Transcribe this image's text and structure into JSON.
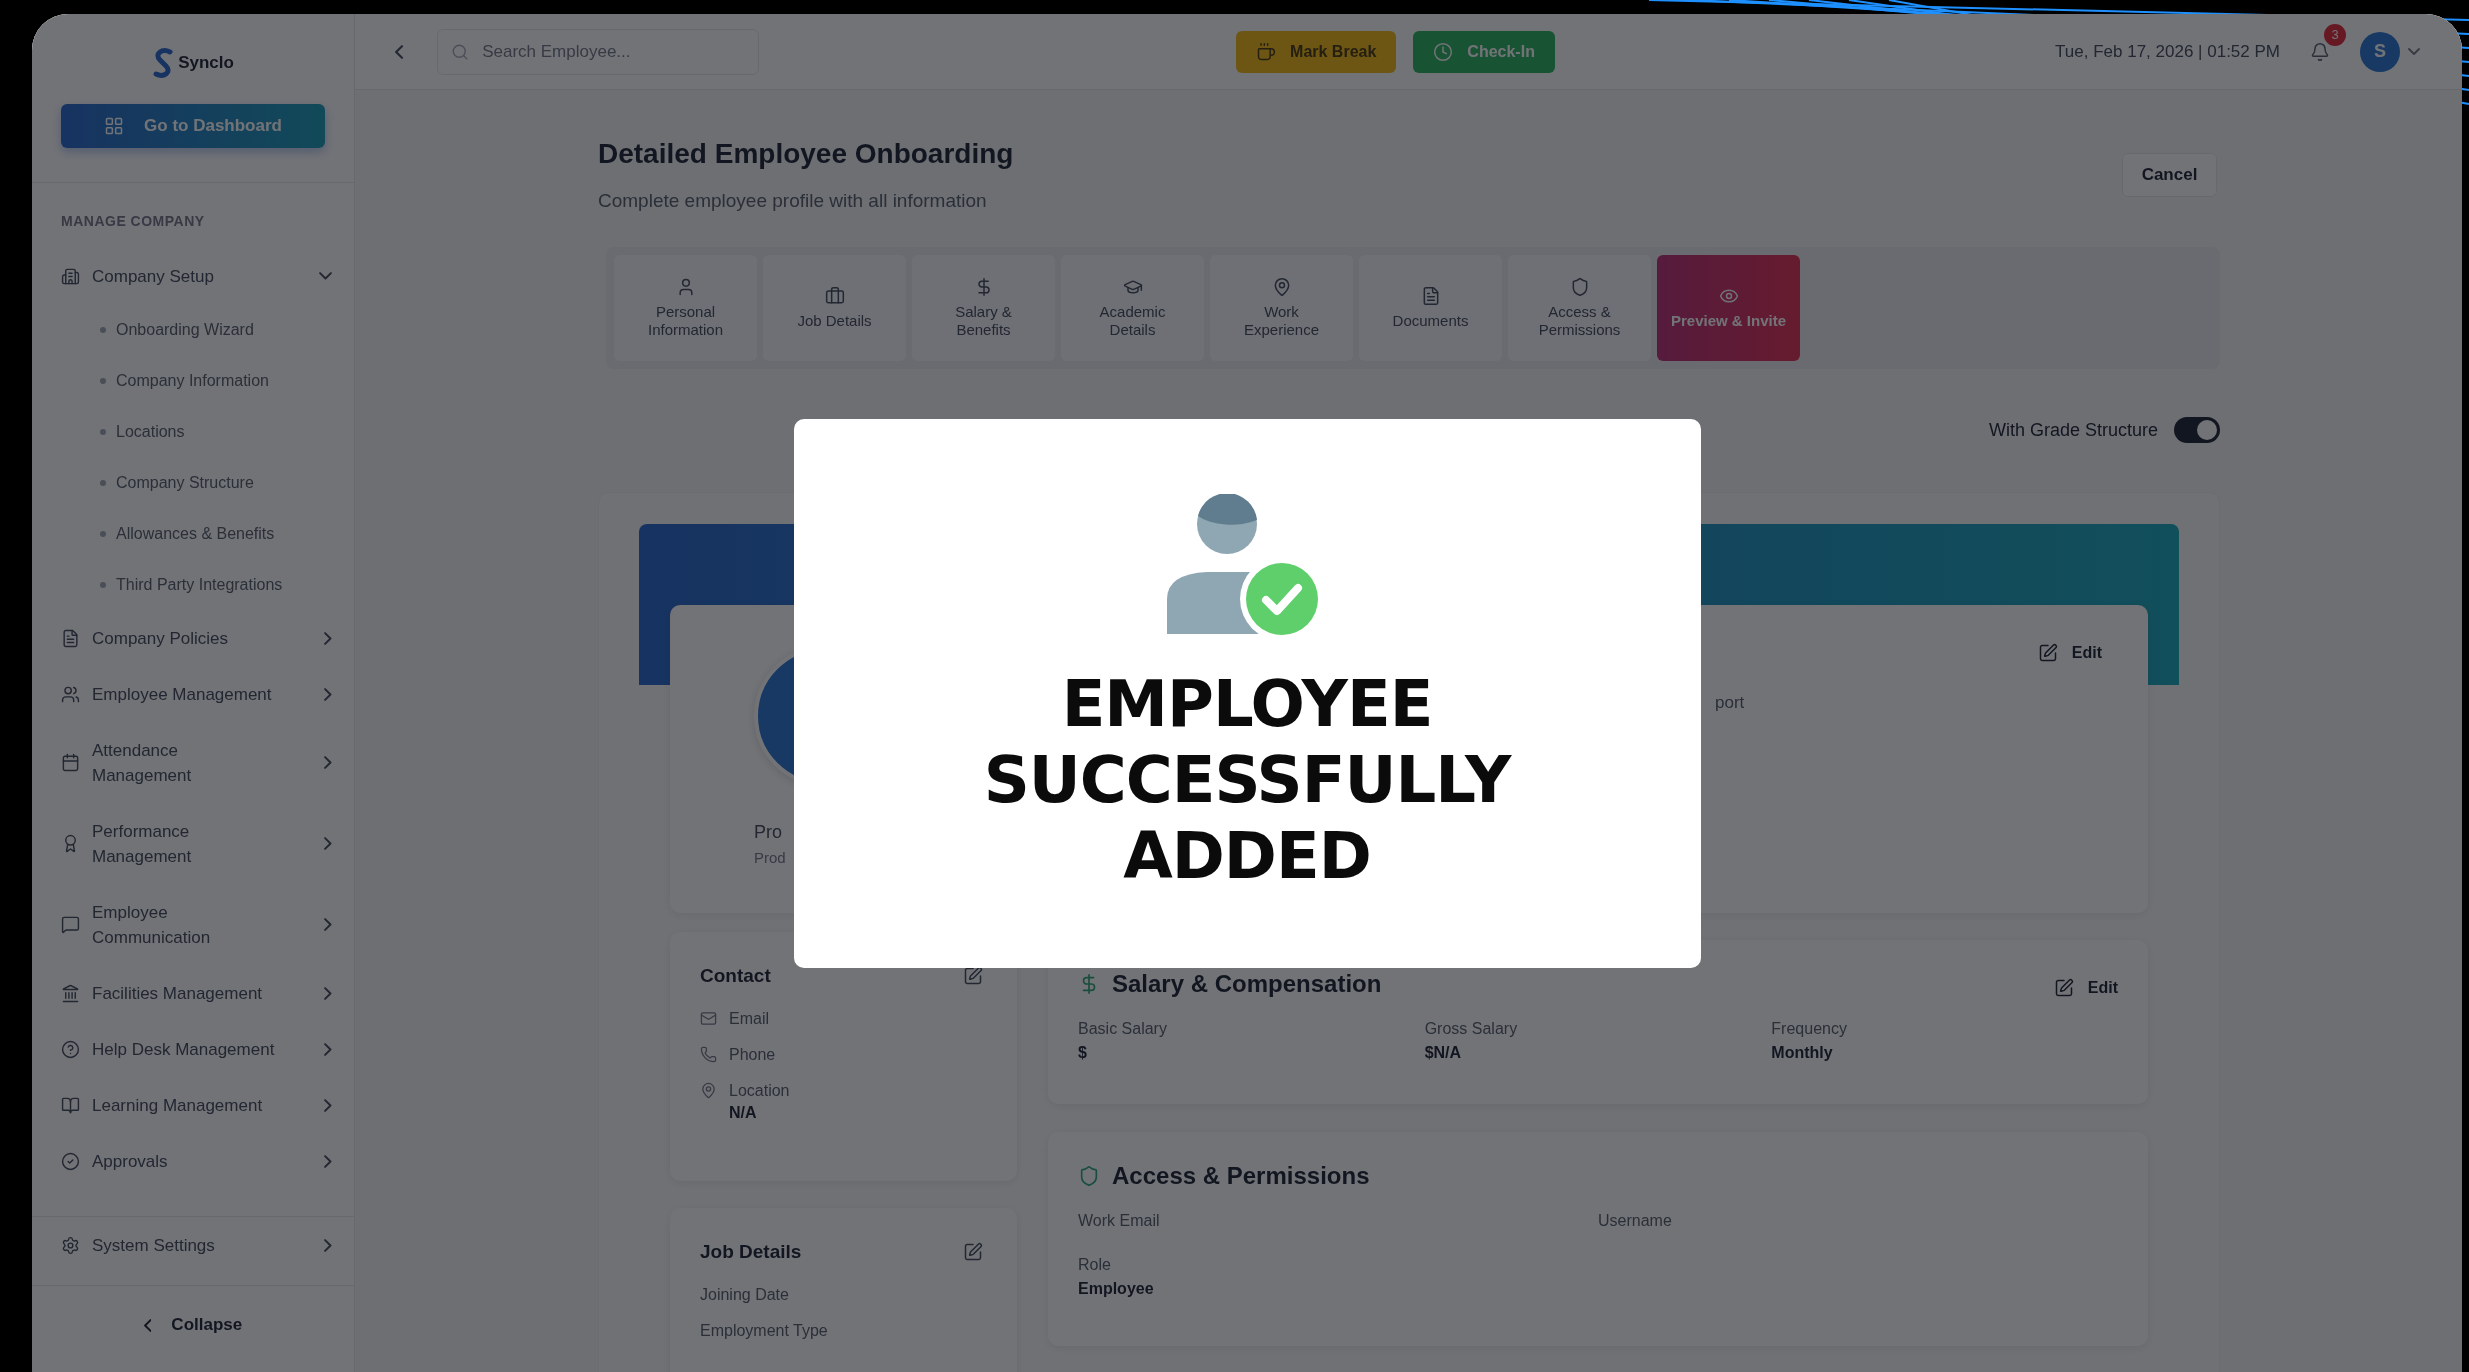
{
  "sidebar": {
    "logo": "Synclo",
    "dashboard_button": "Go to Dashboard",
    "section": "MANAGE COMPANY",
    "items": [
      {
        "label": "Company Setup",
        "expanded": true,
        "children": [
          {
            "label": "Onboarding Wizard"
          },
          {
            "label": "Company Information"
          },
          {
            "label": "Locations"
          },
          {
            "label": "Company Structure"
          },
          {
            "label": "Allowances & Benefits"
          },
          {
            "label": "Third Party Integrations"
          }
        ]
      },
      {
        "label": "Company Policies",
        "expanded": false
      },
      {
        "label": "Employee Management",
        "expanded": false
      },
      {
        "label": "Attendance Management",
        "expanded": false
      },
      {
        "label": "Performance Management",
        "expanded": false
      },
      {
        "label": "Employee Communication",
        "expanded": false
      },
      {
        "label": "Facilities Management",
        "expanded": false
      },
      {
        "label": "Help Desk Management",
        "expanded": false
      },
      {
        "label": "Learning Management",
        "expanded": false
      },
      {
        "label": "Approvals",
        "expanded": false
      }
    ],
    "settings": "System Settings",
    "collapse": "Collapse"
  },
  "topbar": {
    "search": {
      "placeholder": "Search Employee..."
    },
    "buttons": [
      {
        "label": "Mark Break",
        "kind": "break"
      },
      {
        "label": "Check-In",
        "kind": "checkin"
      }
    ],
    "datetime": "Tue, Feb 17, 2026 | 01:52 PM",
    "notifications": "3",
    "avatar": "S"
  },
  "page": {
    "title": "Detailed Employee Onboarding",
    "subtitle": "Complete employee profile with all information",
    "cancel": "Cancel"
  },
  "tabs": [
    {
      "label": "Personal Information",
      "selected": false
    },
    {
      "label": "Job Details",
      "selected": false
    },
    {
      "label": "Salary & Benefits",
      "selected": false
    },
    {
      "label": "Academic Details",
      "selected": false
    },
    {
      "label": "Work Experience",
      "selected": false
    },
    {
      "label": "Documents",
      "selected": false
    },
    {
      "label": "Access & Permissions",
      "selected": false
    },
    {
      "label": "Preview & Invite",
      "selected": true
    }
  ],
  "grade_structure": {
    "label": "With Grade Structure",
    "on": true
  },
  "profile": {
    "name": "Pro",
    "subtitle": "Prod",
    "edit": "Edit",
    "field": "port"
  },
  "contact": {
    "title": "Contact",
    "fields": [
      {
        "label": "Email"
      },
      {
        "label": "Phone"
      },
      {
        "label": "Location",
        "value": "N/A"
      }
    ]
  },
  "job_details": {
    "title": "Job Details",
    "fields": [
      {
        "label": "Joining Date"
      },
      {
        "label": "Employment Type"
      }
    ]
  },
  "salary": {
    "title": "Salary & Compensation",
    "edit": "Edit",
    "fields": [
      {
        "label": "Basic Salary",
        "value": "$"
      },
      {
        "label": "Gross Salary",
        "value": "$N/A"
      },
      {
        "label": "Frequency",
        "value": "Monthly"
      }
    ]
  },
  "access": {
    "title": "Access & Permissions",
    "fields": [
      {
        "label": "Work Email"
      },
      {
        "label": "Username"
      },
      {
        "label": "Role",
        "value": "Employee"
      }
    ]
  },
  "modal": {
    "message": "EMPLOYEE SUCCESSFULLY ADDED"
  }
}
